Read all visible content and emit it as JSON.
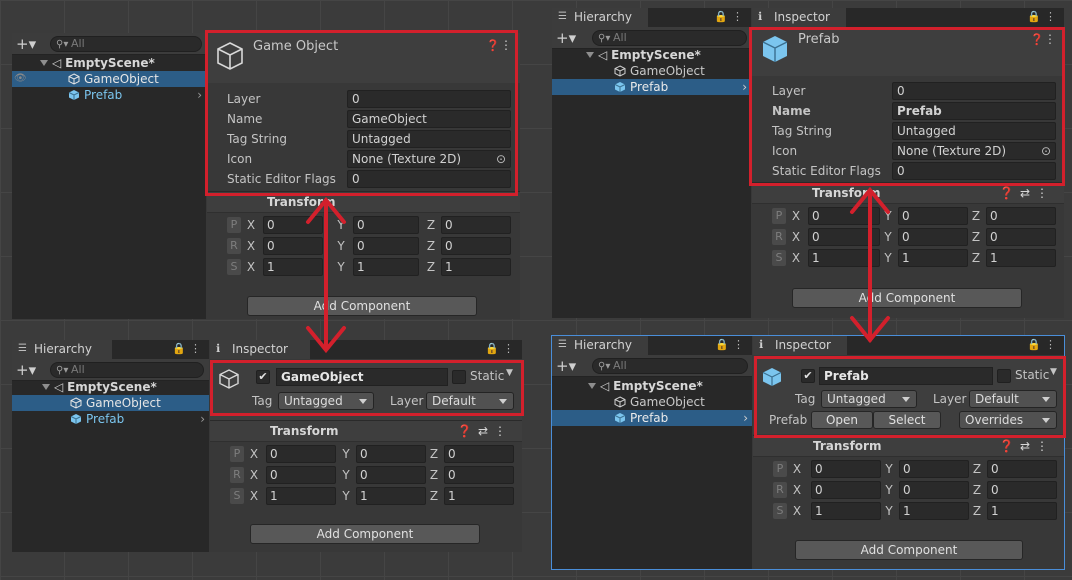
{
  "hierarchy_title": "Hierarchy",
  "inspector_title": "Inspector",
  "search_placeholder": "All",
  "scene_name": "EmptyScene*",
  "objects": {
    "gameobject": "GameObject",
    "prefab": "Prefab"
  },
  "debug_inspector_labels": {
    "layer": "Layer",
    "name": "Name",
    "tag_string": "Tag String",
    "icon": "Icon",
    "static_flags": "Static Editor Flags"
  },
  "debug_go": {
    "title": "Game Object",
    "layer": "0",
    "name": "GameObject",
    "tag": "Untagged",
    "icon": "None (Texture 2D)",
    "static_flags": "0"
  },
  "debug_prefab": {
    "title": "Prefab",
    "layer": "0",
    "name": "Prefab",
    "tag": "Untagged",
    "icon": "None (Texture 2D)",
    "static_flags": "0"
  },
  "transform_label": "Transform",
  "axis": {
    "x": "X",
    "y": "Y",
    "z": "Z"
  },
  "transform_rows": [
    {
      "key": "P",
      "x": "0",
      "y": "0",
      "z": "0"
    },
    {
      "key": "R",
      "x": "0",
      "y": "0",
      "z": "0"
    },
    {
      "key": "S",
      "x": "1",
      "y": "1",
      "z": "1"
    }
  ],
  "add_component_label": "Add Component",
  "normal_header": {
    "tag_label": "Tag",
    "layer_label": "Layer",
    "tag_value": "Untagged",
    "layer_value": "Default",
    "static_label": "Static",
    "go_name": "GameObject",
    "prefab_name": "Prefab",
    "prefab_label": "Prefab",
    "open_label": "Open",
    "select_label": "Select",
    "overrides_label": "Overrides"
  },
  "colors": {
    "highlight": "#d3202c",
    "selection": "#2c5d87",
    "prefab_blue": "#7bc5ee"
  }
}
